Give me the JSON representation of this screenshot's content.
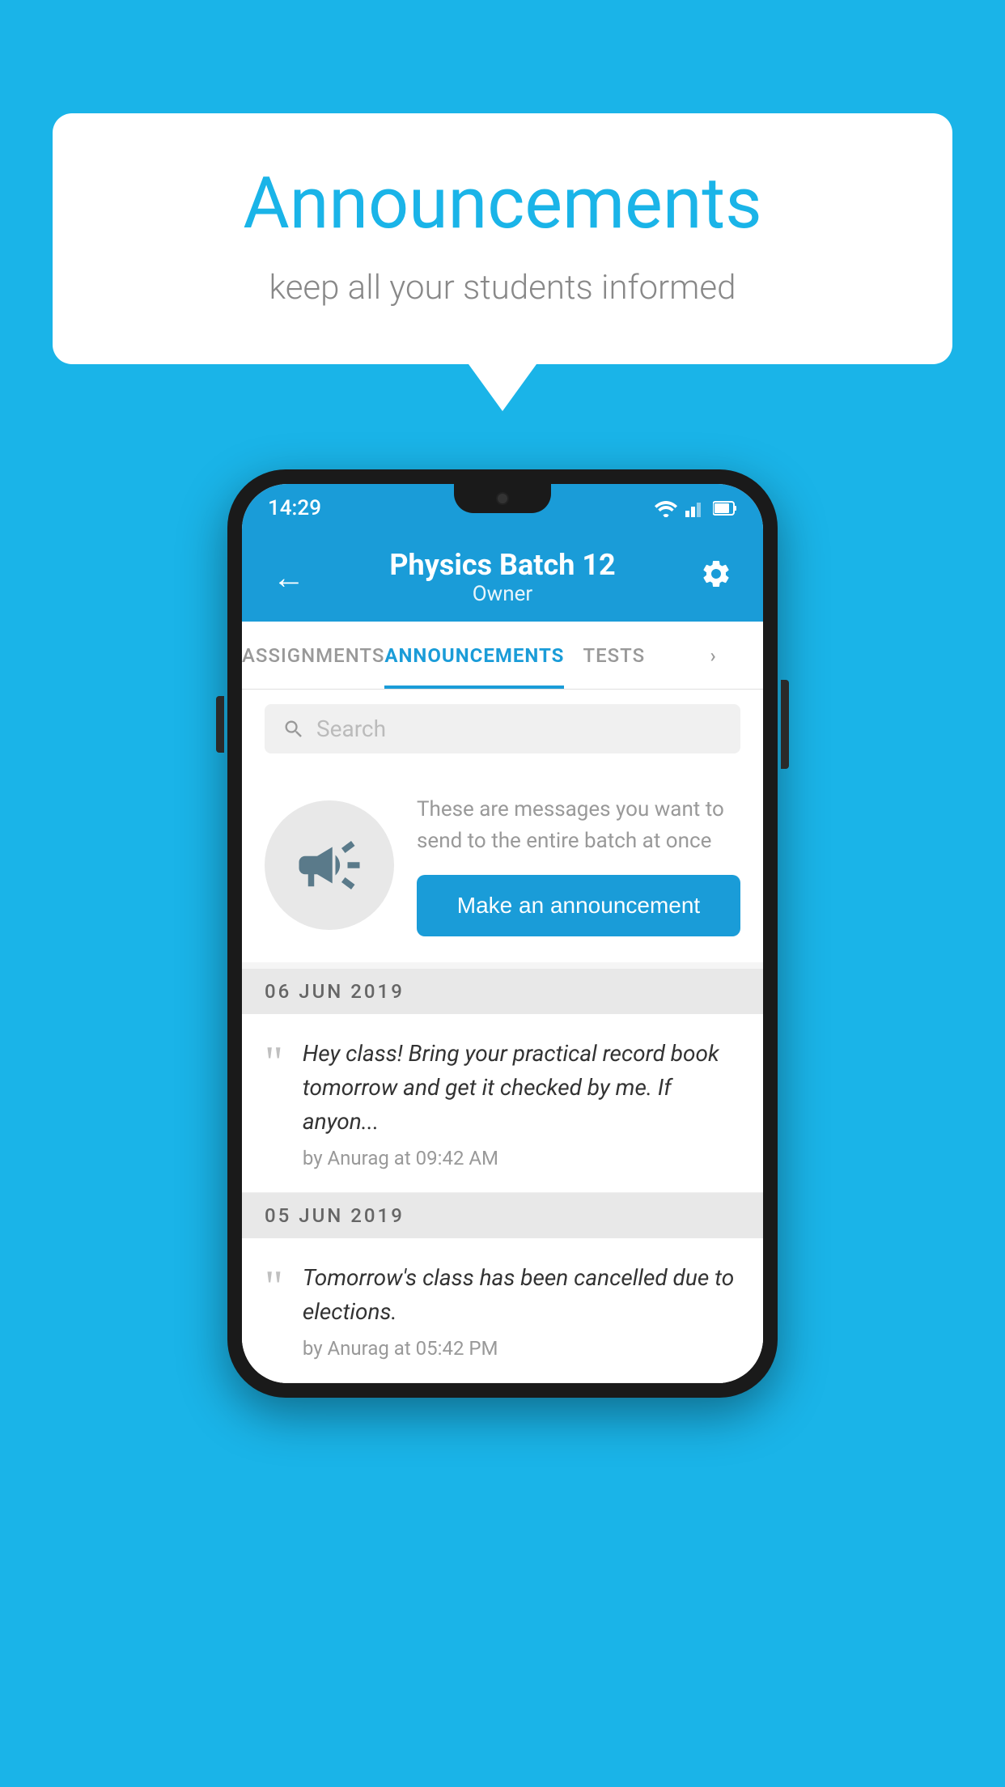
{
  "background_color": "#1ab4e8",
  "speech_bubble": {
    "title": "Announcements",
    "subtitle": "keep all your students informed"
  },
  "phone": {
    "status_bar": {
      "time": "14:29"
    },
    "app_bar": {
      "title": "Physics Batch 12",
      "subtitle": "Owner",
      "back_label": "←",
      "settings_label": "⚙"
    },
    "tabs": [
      {
        "label": "ASSIGNMENTS",
        "active": false
      },
      {
        "label": "ANNOUNCEMENTS",
        "active": true
      },
      {
        "label": "TESTS",
        "active": false
      },
      {
        "label": "...",
        "active": false
      }
    ],
    "search": {
      "placeholder": "Search"
    },
    "promo": {
      "text": "These are messages you want to send to the entire batch at once",
      "button_label": "Make an announcement"
    },
    "announcements": [
      {
        "date": "06  JUN  2019",
        "text": "Hey class! Bring your practical record book tomorrow and get it checked by me. If anyon...",
        "meta": "by Anurag at 09:42 AM"
      },
      {
        "date": "05  JUN  2019",
        "text": "Tomorrow's class has been cancelled due to elections.",
        "meta": "by Anurag at 05:42 PM"
      }
    ]
  },
  "icons": {
    "back": "←",
    "settings": "⚙",
    "search": "🔍",
    "quote": "““"
  }
}
